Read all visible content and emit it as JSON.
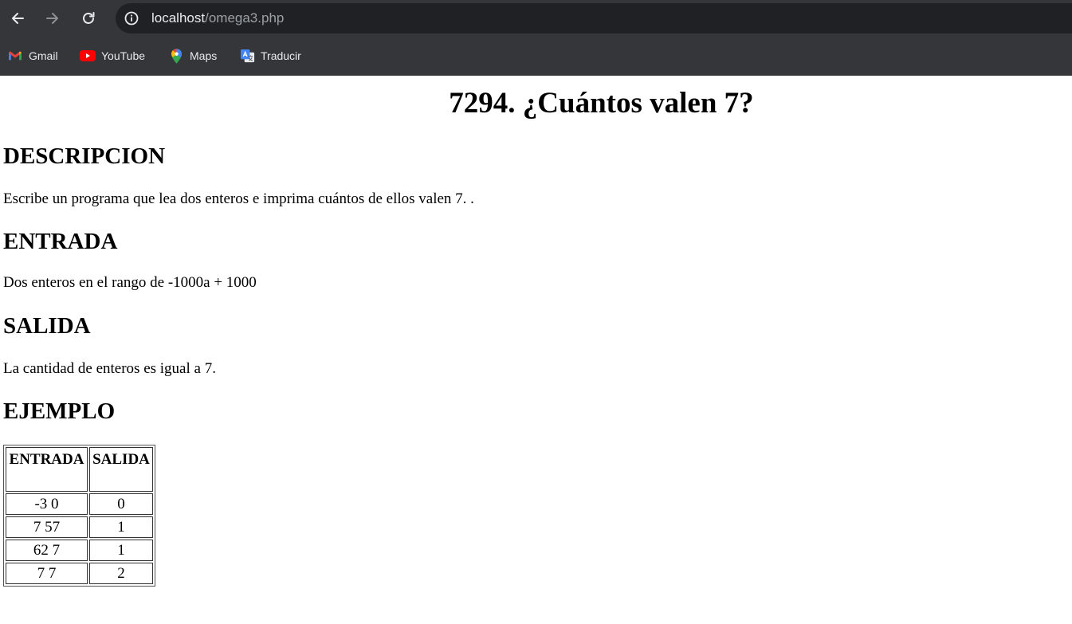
{
  "browser": {
    "url_host": "localhost",
    "url_path": "/omega3.php",
    "bookmarks": [
      {
        "label": "Gmail",
        "icon": "gmail-icon"
      },
      {
        "label": "YouTube",
        "icon": "youtube-icon"
      },
      {
        "label": "Maps",
        "icon": "maps-icon"
      },
      {
        "label": "Traducir",
        "icon": "translate-icon"
      }
    ],
    "colors": {
      "toolbar": "#35363a",
      "omnibox": "#202124"
    }
  },
  "page": {
    "title": "7294. ¿Cuántos valen 7?",
    "sections": {
      "descripcion": {
        "heading": "DESCRIPCION",
        "text": "Escribe un programa que lea dos enteros e imprima cuántos de ellos valen 7. ."
      },
      "entrada": {
        "heading": "ENTRADA",
        "text": "Dos enteros en el rango de -1000a + 1000"
      },
      "salida": {
        "heading": "SALIDA",
        "text": "La cantidad de enteros es igual a 7."
      },
      "ejemplo": {
        "heading": "EJEMPLO"
      }
    },
    "table": {
      "headers": [
        "ENTRADA",
        "SALIDA"
      ],
      "rows": [
        [
          "-3 0",
          "0"
        ],
        [
          "7 57",
          "1"
        ],
        [
          "62 7",
          "1"
        ],
        [
          "7 7",
          "2"
        ]
      ]
    }
  }
}
